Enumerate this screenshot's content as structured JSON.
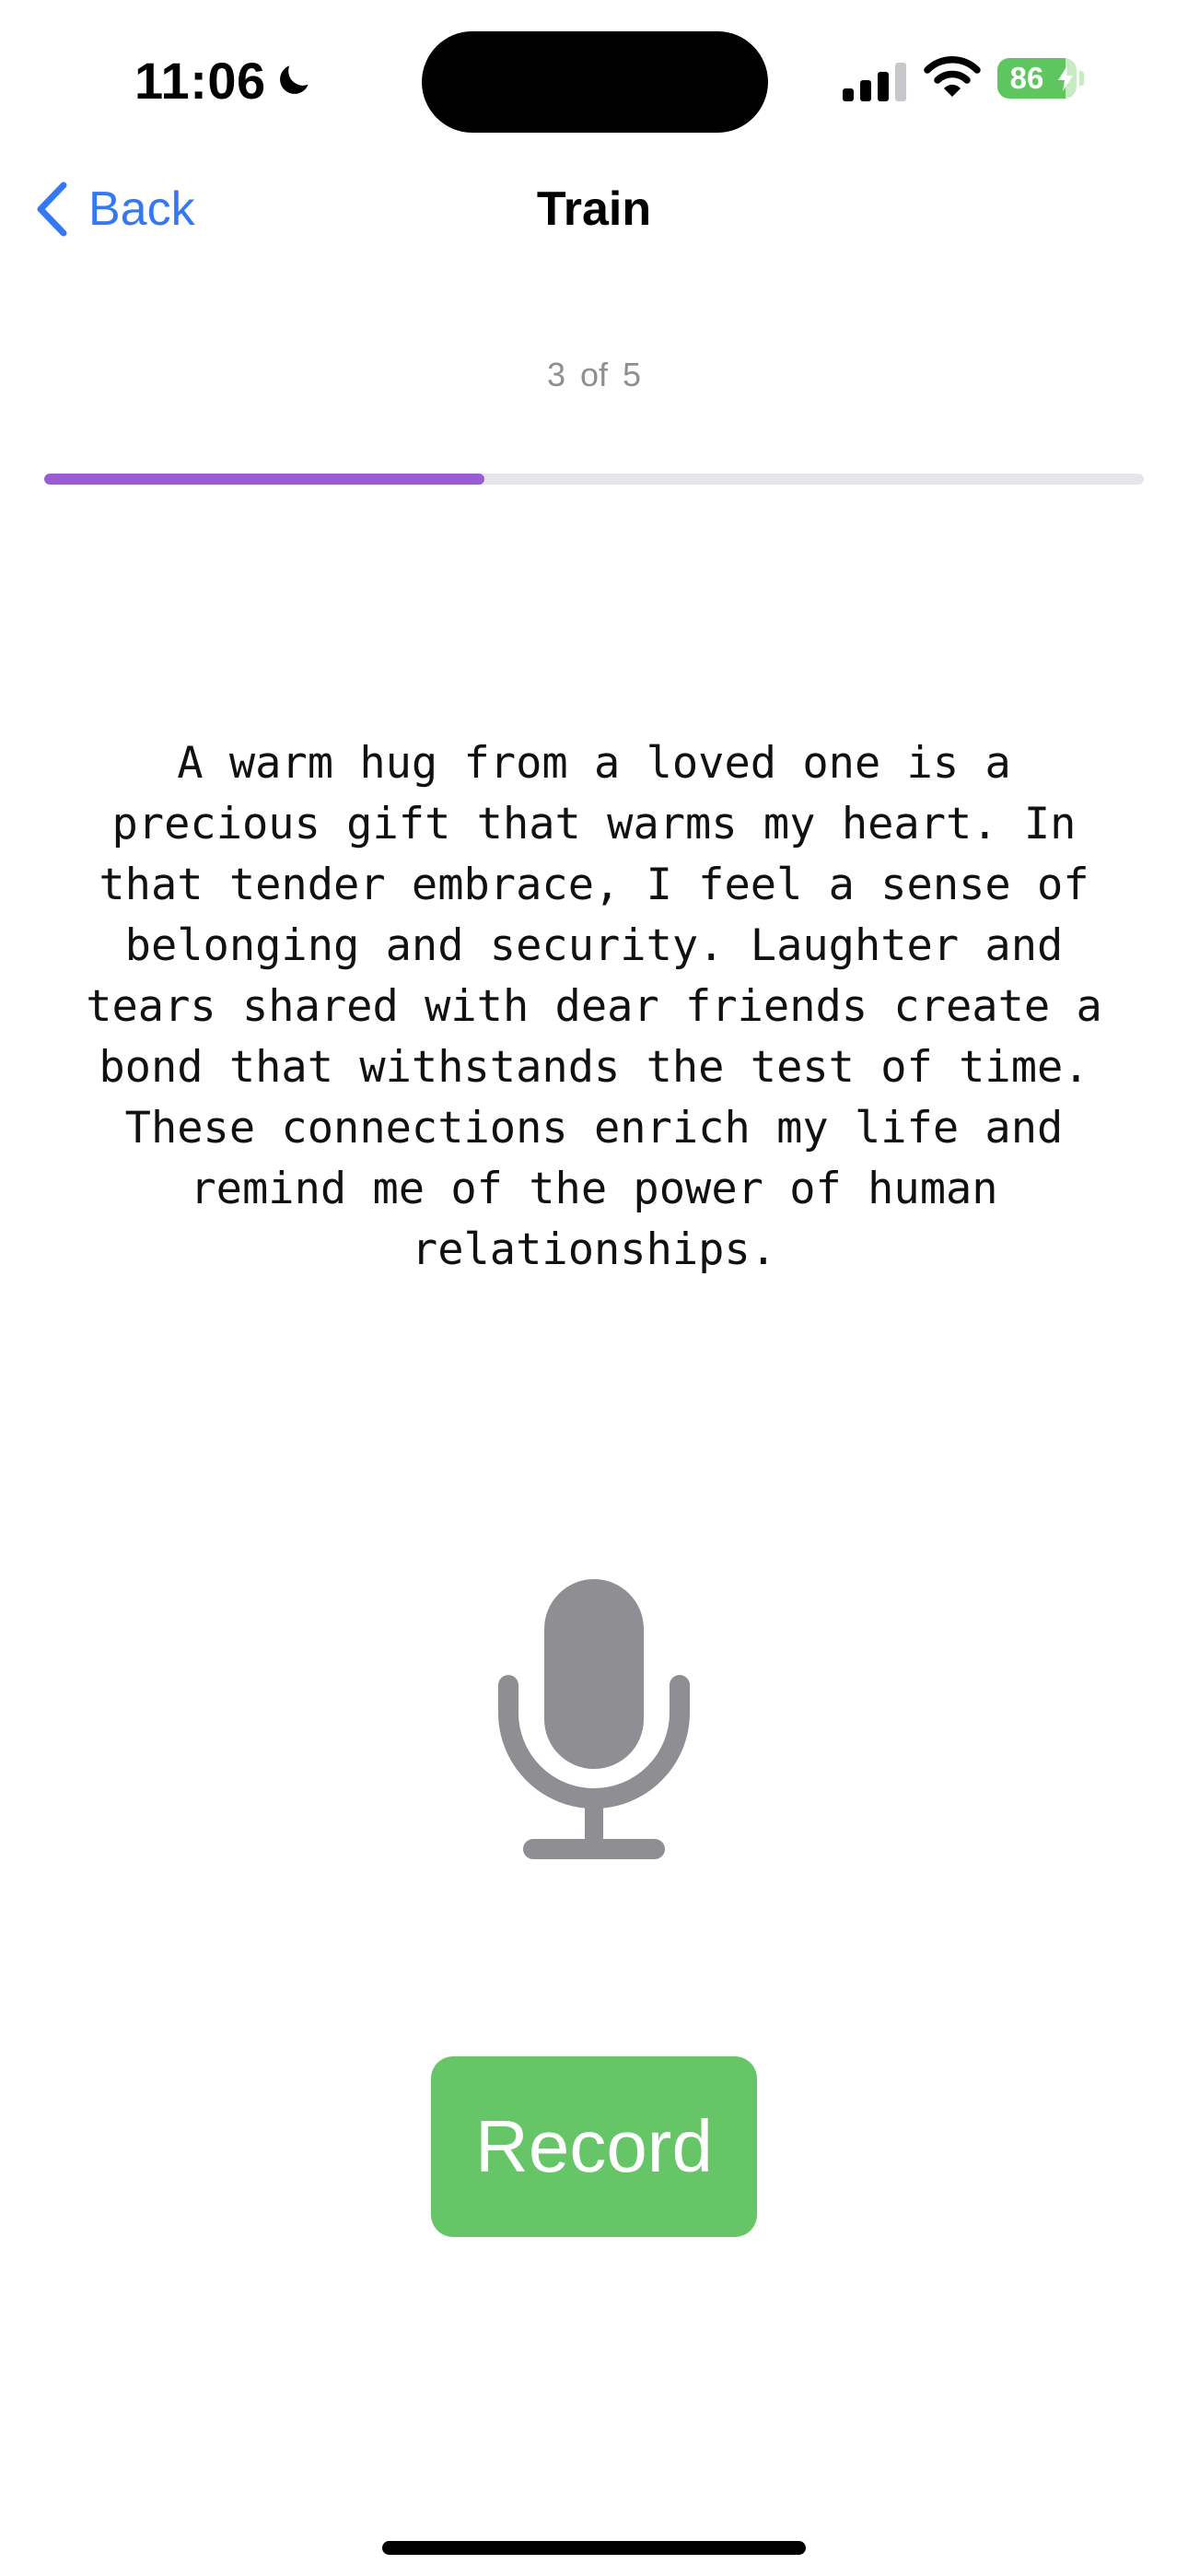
{
  "status_bar": {
    "time": "11:06",
    "battery_level": "86",
    "icons": [
      "moon-icon",
      "signal-icon",
      "wifi-icon",
      "battery-icon",
      "charging-bolt-icon"
    ]
  },
  "nav": {
    "back_label": "Back",
    "title": "Train",
    "back_icon": "chevron-left-icon"
  },
  "progress": {
    "label": "3 of 5",
    "fraction": 0.4
  },
  "prompt": {
    "text": "A warm hug from a loved one is a precious gift that warms my heart. In that tender embrace, I feel a sense of belonging and security. Laughter and tears shared with dear friends create a bond that withstands the test of time. These connections enrich my life and remind me of the power of human relationships."
  },
  "mic": {
    "icon": "microphone-icon"
  },
  "record_button": {
    "label": "Record"
  },
  "colors": {
    "accent_blue": "#3478f6",
    "progress_purple": "#9b5bd4",
    "record_green": "#66c667",
    "mic_gray": "#8e8e93",
    "battery_green": "#5ec65f"
  }
}
